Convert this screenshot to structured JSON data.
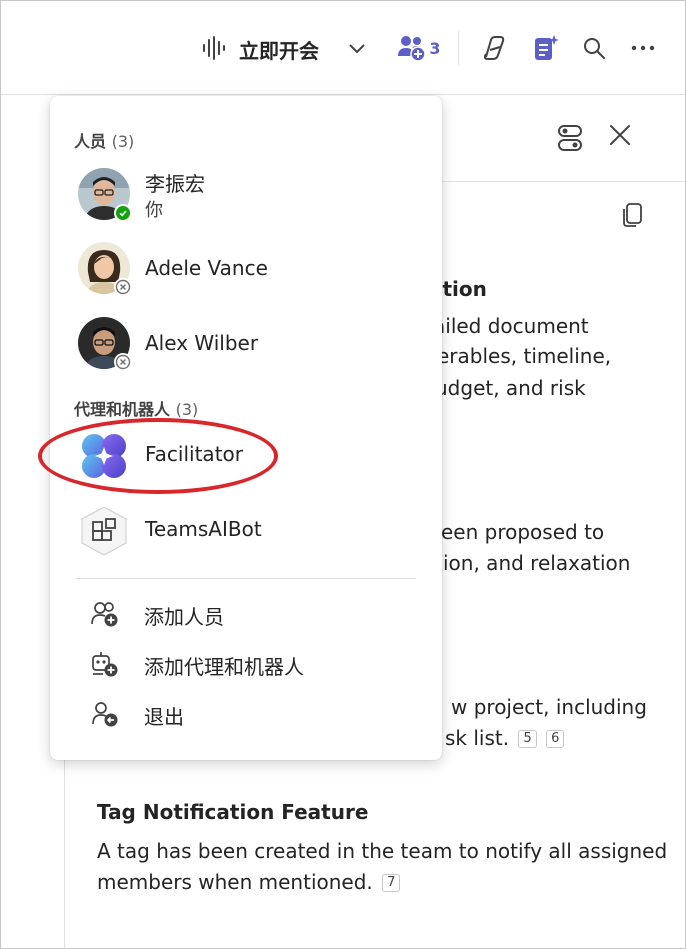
{
  "toolbar": {
    "meet_now_label": "立即开会",
    "people_count": "3"
  },
  "panel": {
    "sections": [
      {
        "id": "s1",
        "heading_tail": "ation",
        "lines": [
          "ailed document",
          "erables, timeline,",
          "udget, and risk"
        ]
      },
      {
        "id": "s2",
        "lines": [
          "een proposed to",
          "ion, and relaxation"
        ]
      },
      {
        "id": "s3",
        "lines": [
          "w project, including",
          "sk list."
        ],
        "citations": [
          "5",
          "6"
        ]
      }
    ],
    "tag_section": {
      "heading": "Tag Notification Feature",
      "line1": "A tag has been created in the team to notify all assigned",
      "line2": "members when mentioned.",
      "citation": "7"
    }
  },
  "dropdown": {
    "people_section": {
      "label": "人员",
      "count": "(3)"
    },
    "people": [
      {
        "name": "李振宏",
        "subtitle": "你",
        "presence": "available",
        "avatar": "avatar-man-glasses"
      },
      {
        "name": "Adele Vance",
        "presence": "offline",
        "avatar": "avatar-woman"
      },
      {
        "name": "Alex Wilber",
        "presence": "offline",
        "avatar": "avatar-man"
      }
    ],
    "agents_section": {
      "label": "代理和机器人",
      "count": "(3)"
    },
    "agents": [
      {
        "name": "Facilitator",
        "icon": "facilitator-icon"
      },
      {
        "name": "TeamsAIBot",
        "icon": "teams-ai-bot-icon"
      }
    ],
    "actions": [
      {
        "label": "添加人员",
        "icon": "add-person-icon"
      },
      {
        "label": "添加代理和机器人",
        "icon": "add-bot-icon"
      },
      {
        "label": "退出",
        "icon": "leave-icon"
      }
    ]
  },
  "colors": {
    "accent": "#5b5fc7",
    "highlight": "#d8262b",
    "available": "#13a10e"
  }
}
